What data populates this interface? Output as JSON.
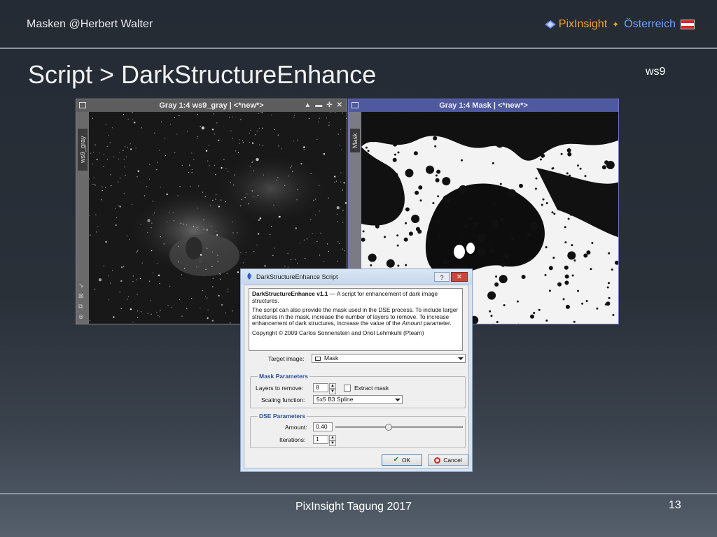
{
  "header": {
    "left_text": "Masken  @Herbert Walter",
    "brand": "PixInsight",
    "country": "Österreich"
  },
  "slide": {
    "title": "Script > DarkStructureEnhance",
    "image_label": "ws9",
    "footer": "PixInsight Tagung 2017",
    "page_number": "13"
  },
  "windows": {
    "gray": {
      "title": "Gray 1:4 ws9_gray | <*new*>",
      "side_label": "ws9_gray"
    },
    "mask": {
      "title": "Gray 1:4 Mask | <*new*>",
      "side_label": "Mask"
    }
  },
  "dialog": {
    "title": "DarkStructureEnhance Script",
    "help_label": "?",
    "close_label": "✕",
    "info_heading": "DarkStructureEnhance v1.1",
    "info_heading_rest": " — A script for enhancement of dark image structures.",
    "info_p2": "The script can also provide the mask used in the DSE process. To include larger structures in the mask, increase the number of layers to remove. To increase enhancement of dark structures, increase the value of the ",
    "info_p2_em": "Amount",
    "info_p2_end": " parameter.",
    "copyright": "Copyright © 2009 Carlos Sonnenstein and Oriol Lehmkuhl (Pteam)",
    "target_label": "Target image:",
    "target_value": "Mask",
    "mask_group": "Mask Parameters",
    "layers_label": "Layers to remove:",
    "layers_value": "8",
    "extract_label": "Extract mask",
    "scaling_label": "Scaling function:",
    "scaling_value": "5x5 B3 Spline",
    "dse_group": "DSE Parameters",
    "amount_label": "Amount:",
    "amount_value": "0.40",
    "amount_fraction": 0.4,
    "iterations_label": "Iterations:",
    "iterations_value": "1",
    "ok_label": "OK",
    "cancel_label": "Cancel"
  },
  "colors": {
    "brand_orange": "#f0a030",
    "brand_blue": "#6aa0ff",
    "group_title": "#2a4f9c"
  }
}
